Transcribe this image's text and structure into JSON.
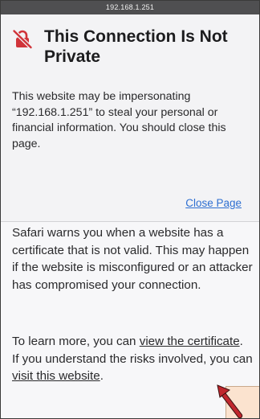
{
  "browser": {
    "url": "192.168.1.251"
  },
  "warning": {
    "icon": "no-lock-icon",
    "title": "This Connection Is Not Private",
    "intro": "This website may be impersonating “192.168.1.251” to steal your personal or financial information. You should close this page.",
    "close_label": "Close Page"
  },
  "details": {
    "text": "Safari warns you when a website has a certificate that is not valid. This may happen if the website is misconfigured or an attacker has compromised your connection.",
    "more_prefix": "To learn more, you can ",
    "view_cert_label": "view the certificate",
    "more_middle": ". If you understand the risks involved, you can ",
    "visit_label": "visit this website",
    "more_suffix": "."
  },
  "colors": {
    "link": "#2e6fd1",
    "warning_icon": "#d0343a",
    "annotation_arrow": "#c0272d",
    "annotation_box": "#fbe3cf"
  }
}
